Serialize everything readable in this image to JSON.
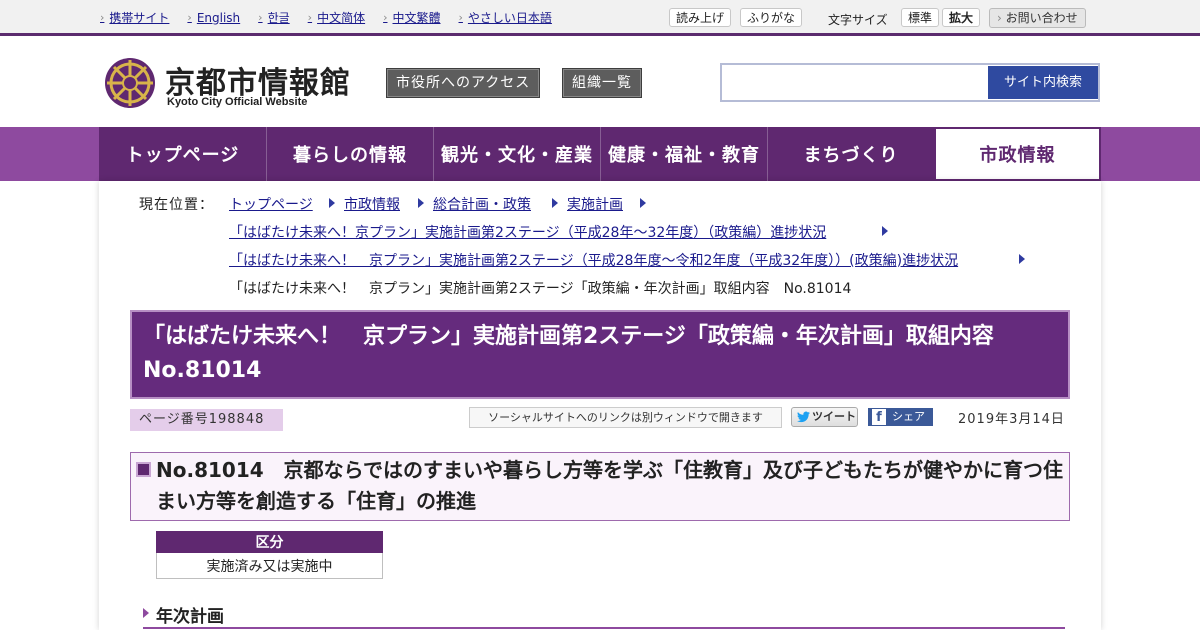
{
  "top_links": [
    "携帯サイト",
    "English",
    "한글",
    "中文简体",
    "中文繁體",
    "やさしい日本語"
  ],
  "tools": {
    "read_aloud": "読み上げ",
    "furigana": "ふりがな",
    "font_size_label": "文字サイズ",
    "font_standard": "標準",
    "font_large": "拡大",
    "contact": "お問い合わせ"
  },
  "header": {
    "site_title": "京都市情報館",
    "site_subtitle": "Kyoto City Official Website",
    "access_button": "市役所へのアクセス",
    "org_button": "組織一覧",
    "search_placeholder": "",
    "search_button": "サイト内検索"
  },
  "nav": [
    "トップページ",
    "暮らしの情報",
    "観光・文化・産業",
    "健康・福祉・教育",
    "まちづくり",
    "市政情報"
  ],
  "breadcrumb": {
    "label": "現在位置：",
    "items": [
      "トップページ",
      "市政情報",
      "総合計画・政策",
      "実施計画"
    ],
    "line2": "「はばたけ未来へ！京プラン」実施計画第2ステージ（平成28年～32年度）（政策編）進捗状況",
    "line3": "「はばたけ未来へ！　京プラン」実施計画第2ステージ（平成28年度～令和2年度（平成32年度））(政策編)進捗状況",
    "current": "「はばたけ未来へ！　京プラン」実施計画第2ステージ「政策編・年次計画」取組内容　No.81014"
  },
  "page_title": "「はばたけ未来へ！　京プラン」実施計画第2ステージ「政策編・年次計画」取組内容　No.81014",
  "page_number": "ページ番号198848",
  "social": {
    "note": "ソーシャルサイトへのリンクは別ウィンドウで開きます",
    "tweet": "ツイート",
    "share": "シェア"
  },
  "date": "2019年3月14日",
  "section_heading": "No.81014　京都ならではのすまいや暮らし方等を学ぶ「住教育」及び子どもたちが健やかに育つ住まい方等を創造する「住育」の推進",
  "status_table": {
    "header": "区分",
    "value": "実施済み又は実施中"
  },
  "subheading": "年次計画",
  "colors": {
    "primary": "#5f2870",
    "nav_bg": "#8e4a9f",
    "link": "#1a1a8c",
    "search_btn": "#2f4aa0"
  }
}
